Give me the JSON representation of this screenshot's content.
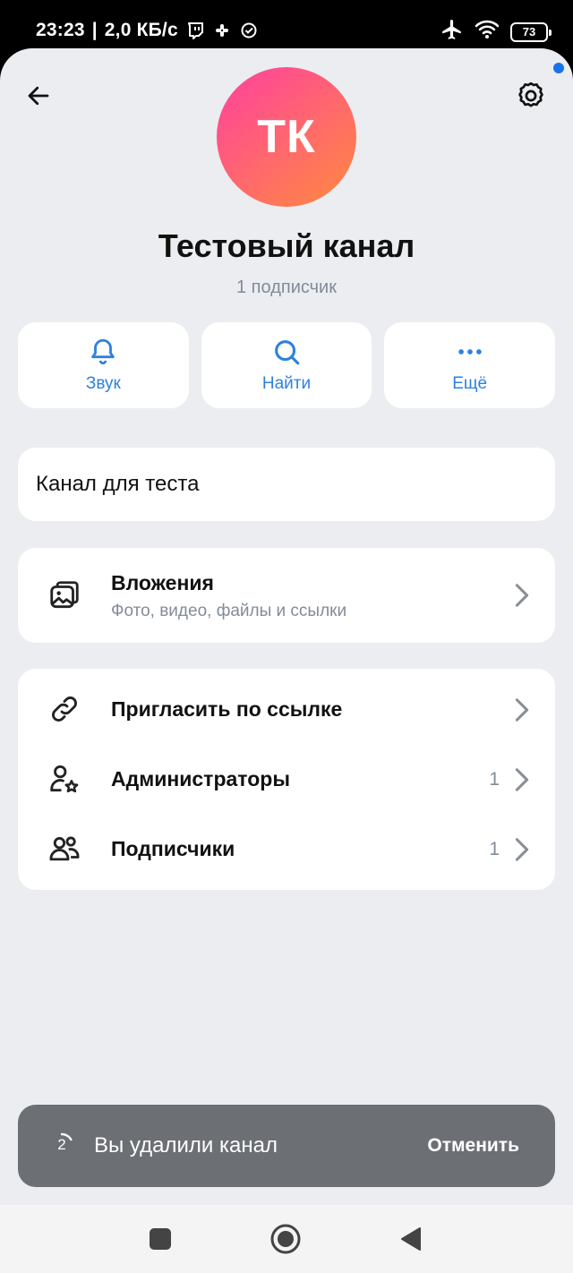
{
  "status_bar": {
    "time": "23:23",
    "network_speed": "2,0 КБ/с",
    "battery_level": "73",
    "icons": [
      "twitch-icon",
      "slack-icon",
      "check-circle-icon",
      "airplane-icon",
      "wifi-icon",
      "battery-icon"
    ]
  },
  "header": {
    "avatar_initials": "ТК",
    "title": "Тестовый канал",
    "subtitle": "1 подписчик",
    "avatar_gradient": [
      "#ff3fa0",
      "#ff8a3d"
    ]
  },
  "actions": [
    {
      "label": "Звук",
      "icon": "bell-icon"
    },
    {
      "label": "Найти",
      "icon": "search-icon"
    },
    {
      "label": "Ещё",
      "icon": "more-dots-icon"
    }
  ],
  "description": "Канал для теста",
  "attachments": {
    "title": "Вложения",
    "subtitle": "Фото, видео, файлы и ссылки",
    "icon": "gallery-icon"
  },
  "links": [
    {
      "label": "Пригласить по ссылке",
      "count": "",
      "icon": "link-icon"
    },
    {
      "label": "Администраторы",
      "count": "1",
      "icon": "user-star-icon"
    },
    {
      "label": "Подписчики",
      "count": "1",
      "icon": "users-icon"
    }
  ],
  "toast": {
    "countdown": "2",
    "message": "Вы удалили канал",
    "action": "Отменить"
  },
  "colors": {
    "accent": "#2d81e0",
    "background": "#ebedf0",
    "secondary_text": "#818c99",
    "toast_bg": "#6c6f73"
  }
}
